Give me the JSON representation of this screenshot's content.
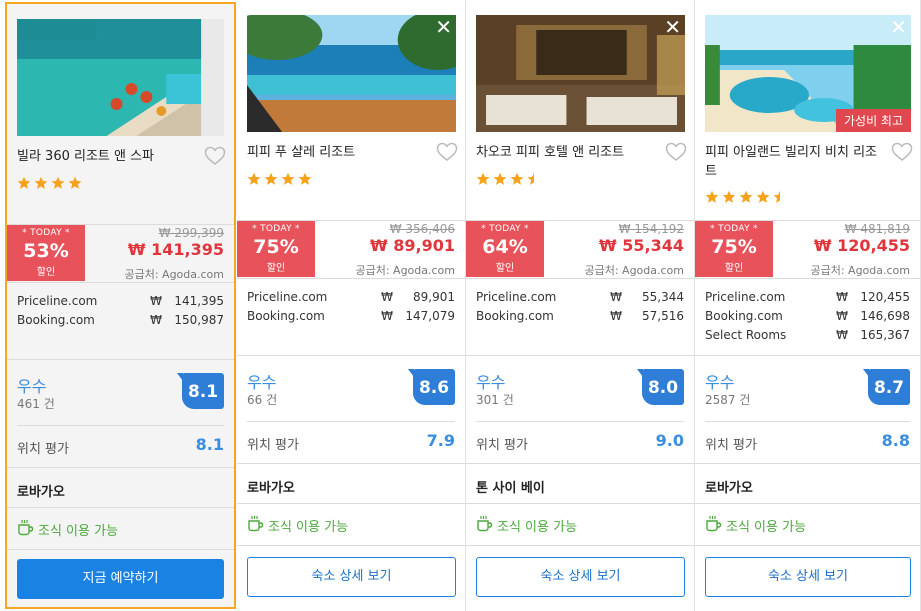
{
  "cards": [
    {
      "name": "빌라 360 리조트 앤 스파",
      "stars": 4,
      "show_close": false,
      "badge": "",
      "today_label": "* TODAY *",
      "discount": "53%",
      "discount_label": "할인",
      "original_price": "₩ 299,399",
      "sale_price": "₩ 141,395",
      "supplier": "공급처: Agoda.com",
      "prices": [
        {
          "site": "Priceline.com",
          "currency": "₩",
          "value": "141,395"
        },
        {
          "site": "Booking.com",
          "currency": "₩",
          "value": "150,987"
        }
      ],
      "rating_word": "우수",
      "review_count": "461 건",
      "score": "8.1",
      "location_label": "위치 평가",
      "location_score": "8.1",
      "area": "로바가오",
      "breakfast": "조식 이용 가능",
      "button": "지금 예약하기",
      "selected": true
    },
    {
      "name": "피피 푸 샬레 리조트",
      "stars": 4,
      "show_close": true,
      "badge": "",
      "today_label": "* TODAY *",
      "discount": "75%",
      "discount_label": "할인",
      "original_price": "₩ 356,406",
      "sale_price": "₩ 89,901",
      "supplier": "공급처: Agoda.com",
      "prices": [
        {
          "site": "Priceline.com",
          "currency": "₩",
          "value": "89,901"
        },
        {
          "site": "Booking.com",
          "currency": "₩",
          "value": "147,079"
        }
      ],
      "rating_word": "우수",
      "review_count": "66 건",
      "score": "8.6",
      "location_label": "위치 평가",
      "location_score": "7.9",
      "area": "로바가오",
      "breakfast": "조식 이용 가능",
      "button": "숙소 상세 보기",
      "selected": false
    },
    {
      "name": "차오코 피피 호텔 앤 리조트",
      "stars": 3.5,
      "show_close": true,
      "badge": "",
      "today_label": "* TODAY *",
      "discount": "64%",
      "discount_label": "할인",
      "original_price": "₩ 154,192",
      "sale_price": "₩ 55,344",
      "supplier": "공급처: Agoda.com",
      "prices": [
        {
          "site": "Priceline.com",
          "currency": "₩",
          "value": "55,344"
        },
        {
          "site": "Booking.com",
          "currency": "₩",
          "value": "57,516"
        }
      ],
      "rating_word": "우수",
      "review_count": "301 건",
      "score": "8.0",
      "location_label": "위치 평가",
      "location_score": "9.0",
      "area": "톤 사이 베이",
      "breakfast": "조식 이용 가능",
      "button": "숙소 상세 보기",
      "selected": false
    },
    {
      "name": "피피 아일랜드 빌리지 비치 리조트",
      "stars": 4.5,
      "show_close": true,
      "badge": "가성비 최고",
      "today_label": "* TODAY *",
      "discount": "75%",
      "discount_label": "할인",
      "original_price": "₩ 481,819",
      "sale_price": "₩ 120,455",
      "supplier": "공급처: Agoda.com",
      "prices": [
        {
          "site": "Priceline.com",
          "currency": "₩",
          "value": "120,455"
        },
        {
          "site": "Booking.com",
          "currency": "₩",
          "value": "146,698"
        },
        {
          "site": "Select Rooms",
          "currency": "₩",
          "value": "165,367"
        }
      ],
      "rating_word": "우수",
      "review_count": "2587 건",
      "score": "8.7",
      "location_label": "위치 평가",
      "location_score": "8.8",
      "area": "로바가오",
      "breakfast": "조식 이용 가능",
      "button": "숙소 상세 보기",
      "selected": false
    }
  ],
  "colors": {
    "accent_blue": "#1a82e2",
    "discount_red": "#e8535b",
    "price_red": "#e0353b",
    "star_orange": "#f7a21b",
    "breakfast_green": "#4caa3c",
    "selected_border": "#f5a623"
  },
  "icons": {
    "heart": "heart-outline-icon",
    "close": "close-icon",
    "star": "star-icon",
    "breakfast": "coffee-cup-icon"
  }
}
